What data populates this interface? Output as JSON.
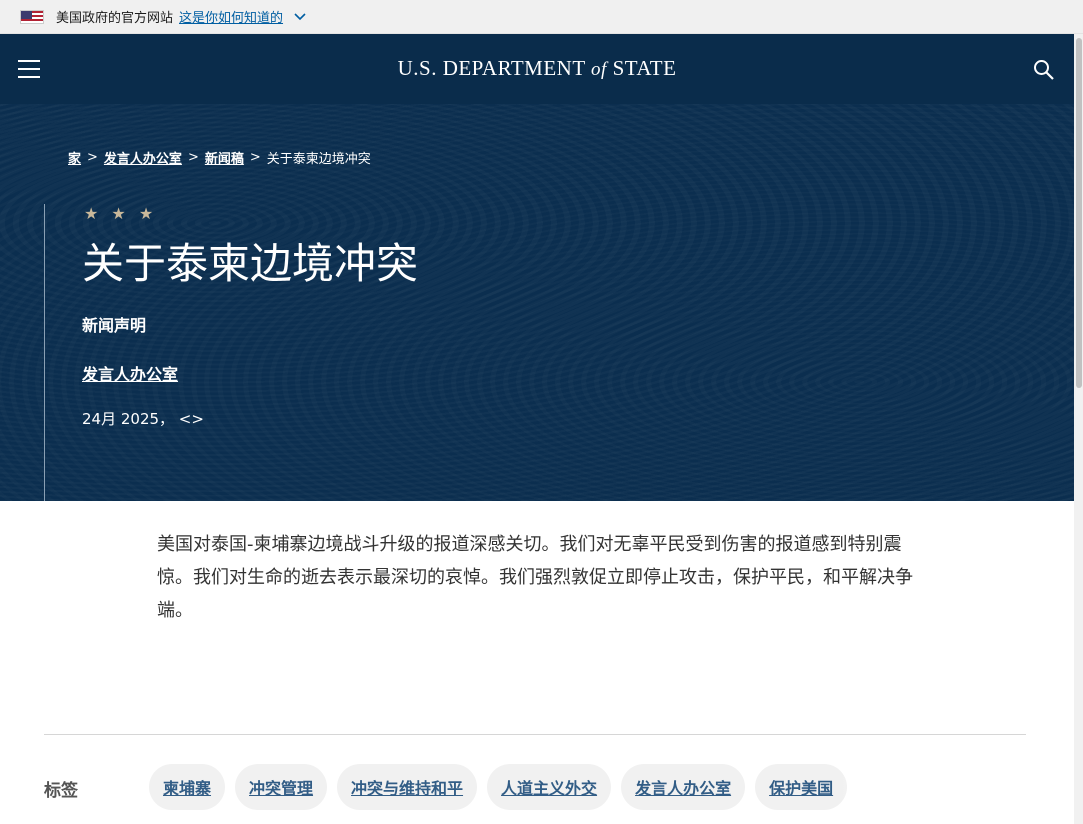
{
  "gov_banner": {
    "text": "美国政府的官方网站",
    "link": "这是你如何知道的"
  },
  "header": {
    "logo_part1": "U.S. DEPARTMENT ",
    "logo_of": "of",
    "logo_part2": " STATE",
    "menu_icon": "hamburger-icon",
    "search_icon": "search-icon"
  },
  "breadcrumb": {
    "items": [
      "家",
      "发言人办公室",
      "新闻稿"
    ],
    "current": "关于泰柬边境冲突",
    "separator": ">"
  },
  "hero": {
    "stars": "★ ★ ★",
    "title": "关于泰柬边境冲突",
    "doc_type": "新闻声明",
    "office": "发言人办公室",
    "date": "24月 2025， <>"
  },
  "body": {
    "paragraph": "美国对泰国-柬埔寨边境战斗升级的报道深感关切。我们对无辜平民受到伤害的报道感到特别震惊。我们对生命的逝去表示最深切的哀悼。我们强烈敦促立即停止攻击，保护平民，和平解决争端。"
  },
  "tags": {
    "label": "标签",
    "items": [
      "柬埔寨",
      "冲突管理",
      "冲突与维持和平",
      "人道主义外交",
      "发言人办公室",
      "保护美国"
    ]
  },
  "colors": {
    "header_bg": "#0a2c4b",
    "tag_text": "#325d86",
    "star": "#c9b89a"
  }
}
